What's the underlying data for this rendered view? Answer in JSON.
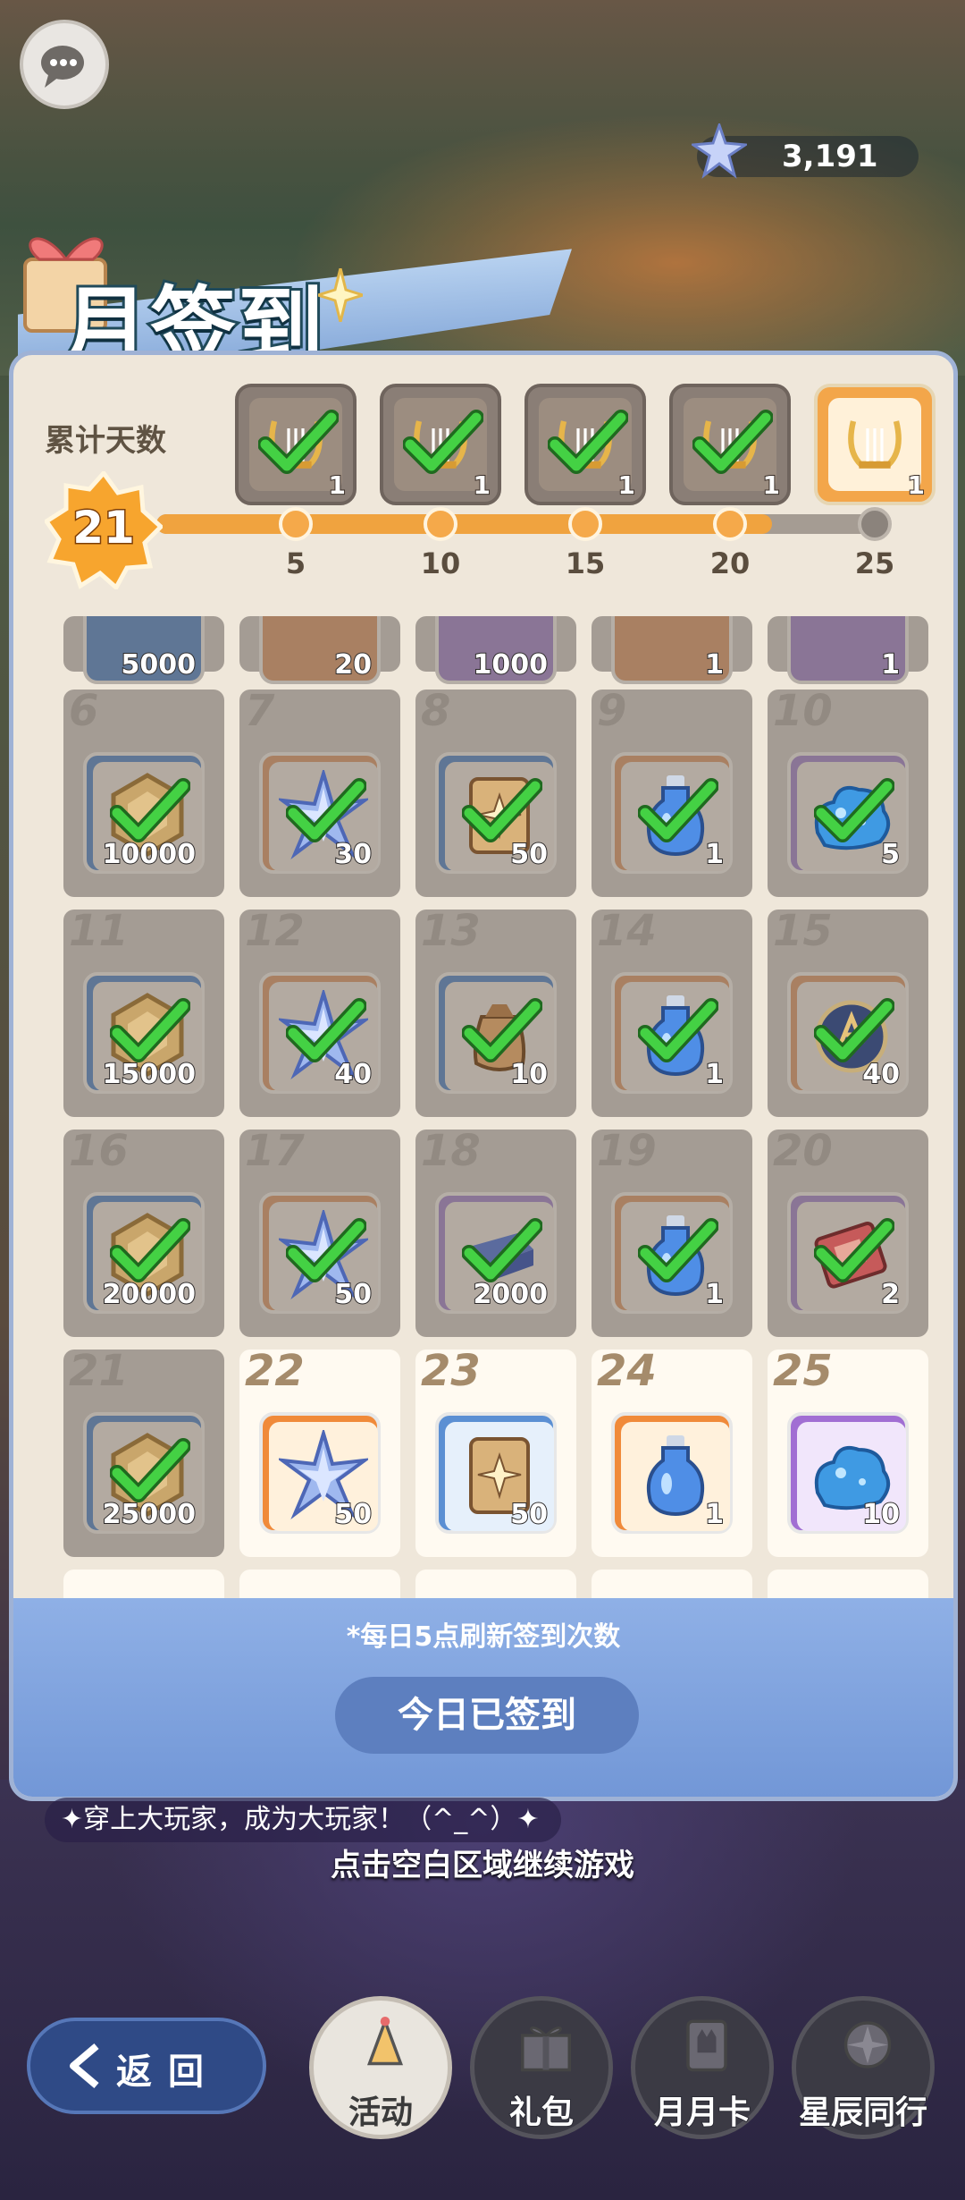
{
  "header": {
    "currency_value": "3,191",
    "title": "月签到"
  },
  "panel": {
    "cumulative_label": "累计天数",
    "current_day": "21",
    "progress_fraction": 0.84,
    "top_rewards": [
      {
        "icon": "lyre-icon",
        "count": "1",
        "claimed": true
      },
      {
        "icon": "lyre-icon",
        "count": "1",
        "claimed": true
      },
      {
        "icon": "lyre-icon",
        "count": "1",
        "claimed": true
      },
      {
        "icon": "lyre-icon",
        "count": "1",
        "claimed": true
      },
      {
        "icon": "lyre-icon",
        "count": "1",
        "claimed": false
      }
    ],
    "milestones": [
      "5",
      "10",
      "15",
      "20",
      "25"
    ],
    "partial_top_row": [
      "5000",
      "20",
      "1000",
      "1",
      "1"
    ],
    "days": [
      {
        "day": "6",
        "icon": "coin-icon",
        "qty": "10000",
        "rarity": "blue",
        "claimed": true
      },
      {
        "day": "7",
        "icon": "star-crystal-icon",
        "qty": "30",
        "rarity": "orange",
        "claimed": true
      },
      {
        "day": "8",
        "icon": "card-icon",
        "qty": "50",
        "rarity": "blue",
        "claimed": true
      },
      {
        "day": "9",
        "icon": "potion-icon",
        "qty": "1",
        "rarity": "orange",
        "claimed": true
      },
      {
        "day": "10",
        "icon": "slime-icon",
        "qty": "5",
        "rarity": "purple",
        "claimed": true
      },
      {
        "day": "11",
        "icon": "coin-icon",
        "qty": "15000",
        "rarity": "blue",
        "claimed": true
      },
      {
        "day": "12",
        "icon": "star-crystal-icon",
        "qty": "40",
        "rarity": "orange",
        "claimed": true
      },
      {
        "day": "13",
        "icon": "bag-icon",
        "qty": "10",
        "rarity": "blue",
        "claimed": true
      },
      {
        "day": "14",
        "icon": "potion-icon",
        "qty": "1",
        "rarity": "orange",
        "claimed": true
      },
      {
        "day": "15",
        "icon": "orb-icon",
        "qty": "40",
        "rarity": "orange",
        "claimed": true
      },
      {
        "day": "16",
        "icon": "coin-icon",
        "qty": "20000",
        "rarity": "blue",
        "claimed": true
      },
      {
        "day": "17",
        "icon": "star-crystal-icon",
        "qty": "50",
        "rarity": "orange",
        "claimed": true
      },
      {
        "day": "18",
        "icon": "ingot-icon",
        "qty": "2000",
        "rarity": "purple",
        "claimed": true
      },
      {
        "day": "19",
        "icon": "potion-icon",
        "qty": "1",
        "rarity": "orange",
        "claimed": true
      },
      {
        "day": "20",
        "icon": "ticket-icon",
        "qty": "2",
        "rarity": "purple",
        "claimed": true
      },
      {
        "day": "21",
        "icon": "coin-icon",
        "qty": "25000",
        "rarity": "blue",
        "claimed": true
      },
      {
        "day": "22",
        "icon": "star-crystal-icon",
        "qty": "50",
        "rarity": "orange",
        "claimed": false
      },
      {
        "day": "23",
        "icon": "card-icon",
        "qty": "50",
        "rarity": "blue",
        "claimed": false
      },
      {
        "day": "24",
        "icon": "potion-icon",
        "qty": "1",
        "rarity": "orange",
        "claimed": false
      },
      {
        "day": "25",
        "icon": "slime-icon",
        "qty": "10",
        "rarity": "purple",
        "claimed": false
      }
    ],
    "refresh_note": "*每日5点刷新签到次数",
    "signed_button": "今日已签到"
  },
  "overlay": {
    "slogan": "✦穿上大玩家，成为大玩家！（^_^）✦",
    "continue_hint": "点击空白区域继续游戏"
  },
  "nav": {
    "back_label": "返回",
    "items": [
      {
        "label": "活动",
        "icon": "party-hat-icon",
        "active": true
      },
      {
        "label": "礼包",
        "icon": "gift-box-icon",
        "active": false
      },
      {
        "label": "月月卡",
        "icon": "card-cat-icon",
        "active": false
      },
      {
        "label": "星辰同行",
        "icon": "compass-star-icon",
        "active": false
      }
    ]
  },
  "colors": {
    "accent_orange": "#f0a33f",
    "panel_bg": "#efe7da",
    "footer_blue": "#7f9fdd",
    "check_green": "#3fd13f"
  }
}
